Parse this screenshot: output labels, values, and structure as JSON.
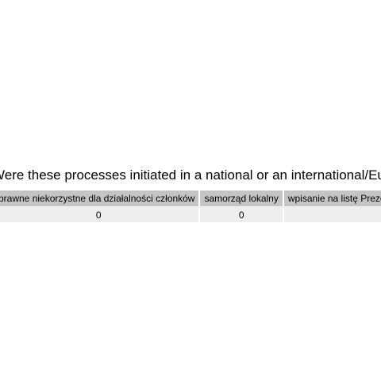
{
  "title": "Were these processes initiated in a national or an international/European",
  "table": {
    "headers": [
      "prawne niekorzystne dla działalności członków",
      "samorząd lokalny",
      "wpisanie na listę Prezesa"
    ],
    "rows": [
      [
        "0",
        "0",
        ""
      ]
    ]
  }
}
